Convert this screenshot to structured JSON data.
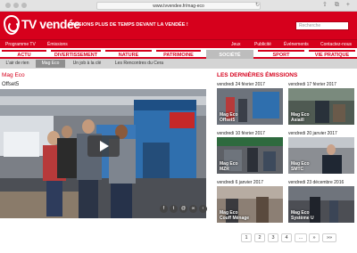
{
  "browser": {
    "url": "www.tvvendee.fr/mag-eco",
    "reload": "↻",
    "icons": [
      {
        "name": "upload-icon",
        "glyph": "⇧"
      },
      {
        "name": "tabs-icon",
        "glyph": "⧉"
      },
      {
        "name": "add-tab-icon",
        "glyph": "+"
      }
    ]
  },
  "site": {
    "logo": "TV vendée",
    "tagline": "PASSIONS PLUS DE TEMPS DEVANT LA VENDÉE !",
    "search_placeholder": "Recherche",
    "brand_color": "#d6001c"
  },
  "top_links": [
    "Programme TV",
    "Émissions",
    "Jeux",
    "Publicité",
    "Événements",
    "Contactez-nous"
  ],
  "nav": [
    {
      "label": "ACTU",
      "active": false
    },
    {
      "label": "DIVERTISSEMENT",
      "active": false
    },
    {
      "label": "NATURE",
      "active": false
    },
    {
      "label": "PATRIMOINE",
      "active": false
    },
    {
      "label": "SOCIÉTÉ",
      "active": true
    },
    {
      "label": "SPORT",
      "active": false
    },
    {
      "label": "VIE PRATIQUE",
      "active": false
    }
  ],
  "subnav": [
    {
      "label": "L'air de rien",
      "active": false
    },
    {
      "label": "Mag Eco",
      "active": true
    },
    {
      "label": "Un job à la clé",
      "active": false
    },
    {
      "label": "Les Rencontres du Cera",
      "active": false
    }
  ],
  "main": {
    "section_title": "Mag Eco",
    "video_title": "Offset5",
    "share_icons": [
      {
        "name": "facebook-icon",
        "glyph": "f"
      },
      {
        "name": "twitter-icon",
        "glyph": "t"
      },
      {
        "name": "email-icon",
        "glyph": "@"
      },
      {
        "name": "link-icon",
        "glyph": "∞"
      },
      {
        "name": "embed-icon",
        "glyph": "‹"
      }
    ]
  },
  "sidebar": {
    "title": "LES DERNIÈRES ÉMISSIONS",
    "cards": [
      {
        "date": "vendredi 24 février 2017",
        "caption": "Mag Eco\nOffset5"
      },
      {
        "date": "vendredi 17 février 2017",
        "caption": "Mag Eco\nAsiaill"
      },
      {
        "date": "vendredi 10 février 2017",
        "caption": "Mag Eco\nMZR"
      },
      {
        "date": "vendredi 20 janvier 2017",
        "caption": "Mag Eco\nSMTC"
      },
      {
        "date": "vendredi 6 janvier 2017",
        "caption": "Mag Eco\nCouff Ménage"
      },
      {
        "date": "vendredi 23 décembre 2016",
        "caption": "Mag Eco\nSystème U"
      }
    ]
  },
  "pagination": [
    "1",
    "2",
    "3",
    "4",
    "...",
    "»",
    "»»"
  ]
}
